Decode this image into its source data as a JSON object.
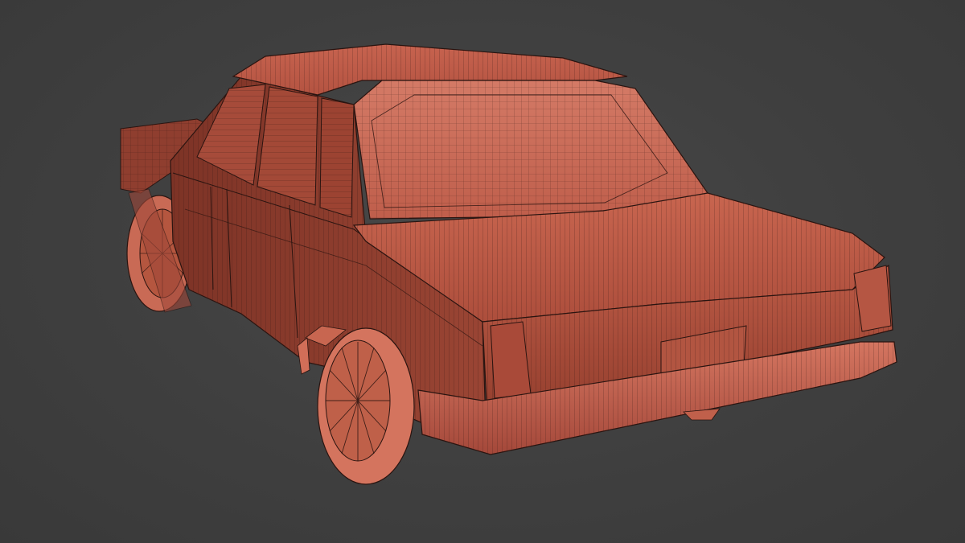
{
  "scene": {
    "subject": "car-wireframe-mesh",
    "view": "rear-three-quarter",
    "shading": "solid-with-wireframe-overlay"
  },
  "colors": {
    "background": "#3f3f3f",
    "body_mid": "#b4523f",
    "body_light": "#cf6a55",
    "body_dark": "#7a3023",
    "wire": "#2a1410",
    "wheel": "#d4745e"
  }
}
